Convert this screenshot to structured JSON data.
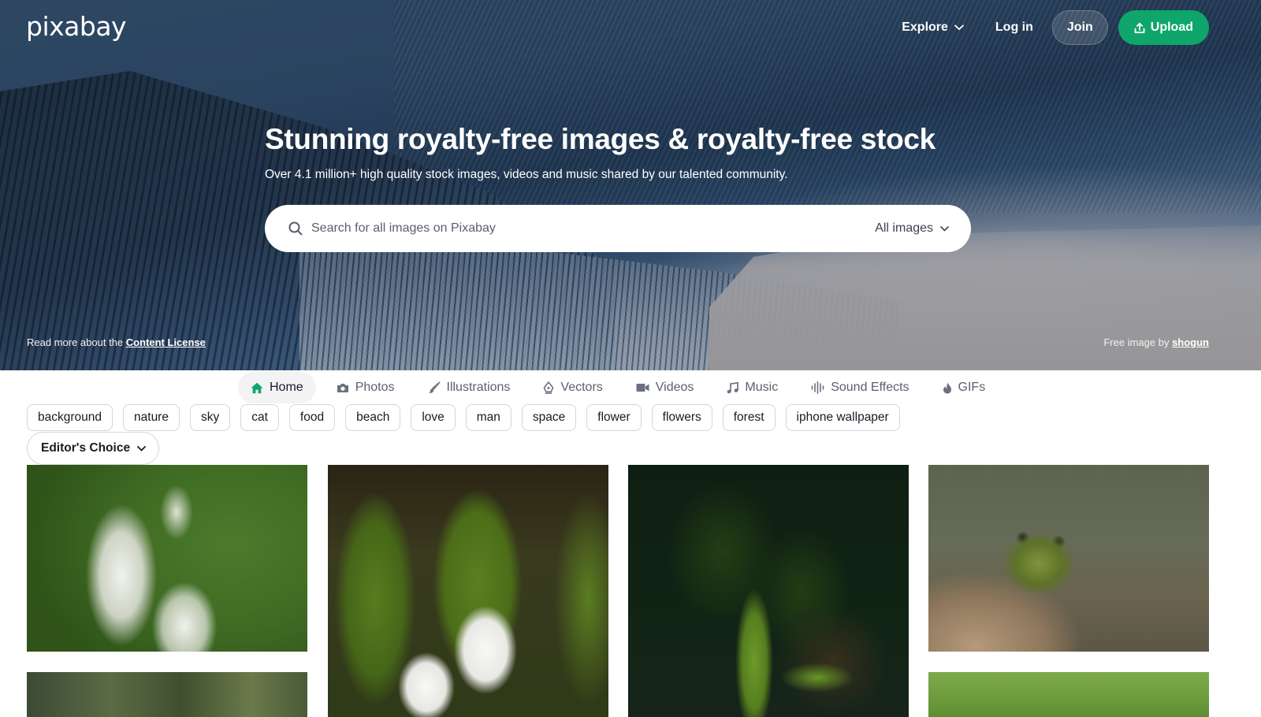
{
  "header": {
    "logo": "pixabay",
    "nav": {
      "explore_label": "Explore",
      "login_label": "Log in",
      "join_label": "Join",
      "upload_label": "Upload"
    }
  },
  "hero": {
    "title": "Stunning royalty-free images & royalty-free stock",
    "subtitle": "Over 4.1 million+ high quality stock images, videos and music shared by our talented community.",
    "search": {
      "placeholder": "Search for all images on Pixabay",
      "value": "",
      "type_selected": "All images"
    },
    "license_prefix": "Read more about the ",
    "license_link": "Content License",
    "credit_prefix": "Free image by ",
    "credit_author": "shogun"
  },
  "tabs": [
    {
      "label": "Home",
      "icon": "home-icon",
      "active": true
    },
    {
      "label": "Photos",
      "icon": "camera-icon",
      "active": false
    },
    {
      "label": "Illustrations",
      "icon": "brush-icon",
      "active": false
    },
    {
      "label": "Vectors",
      "icon": "pen-nib-icon",
      "active": false
    },
    {
      "label": "Videos",
      "icon": "video-camera-icon",
      "active": false
    },
    {
      "label": "Music",
      "icon": "music-note-icon",
      "active": false
    },
    {
      "label": "Sound Effects",
      "icon": "sound-wave-icon",
      "active": false
    },
    {
      "label": "GIFs",
      "icon": "flame-icon",
      "active": false
    }
  ],
  "tags": [
    "background",
    "nature",
    "sky",
    "cat",
    "food",
    "beach",
    "love",
    "man",
    "space",
    "flower",
    "flowers",
    "forest",
    "iphone wallpaper"
  ],
  "filter": {
    "label": "Editor's Choice"
  },
  "colors": {
    "accent": "#0ea66b",
    "active_tab_icon": "#0ea66b",
    "text": "#191b26",
    "muted_text": "#5a5f6e"
  },
  "photos": [
    {
      "subject": "white flower spikes on green background"
    },
    {
      "subject": "white plumeria flowers with leaves"
    },
    {
      "subject": "green leaf on dark background"
    },
    {
      "subject": "frog in water"
    },
    {
      "subject": "forest scene"
    },
    {
      "subject": "green grass"
    }
  ]
}
